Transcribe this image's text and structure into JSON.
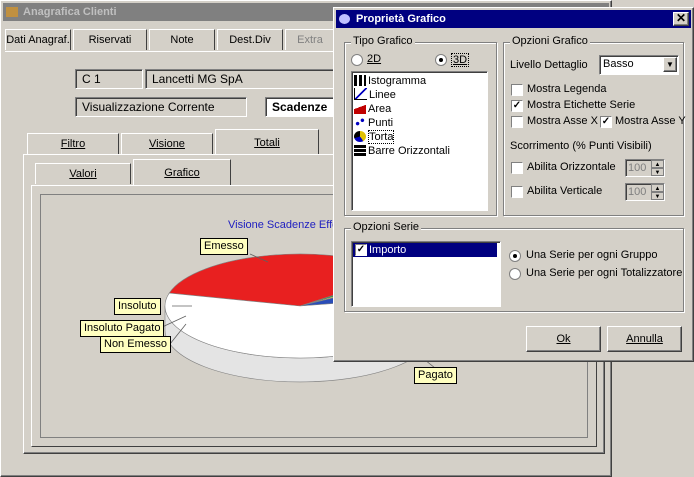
{
  "main_window": {
    "title": "Anagrafica Clienti",
    "top_tabs": [
      "Dati Anagraf.",
      "Riservati",
      "Note",
      "Dest.Div",
      "Extra"
    ],
    "code_field": "C    1",
    "name_field": "Lancetti MG SpA",
    "view_label": "Visualizzazione Corrente",
    "view_select": "Scadenze",
    "sub_tabs": [
      "Filtro",
      "Visione",
      "Totali"
    ],
    "inner_tabs": [
      "Valori",
      "Grafico"
    ],
    "chart_title": "Visione Scadenze Effe"
  },
  "chart_data": {
    "type": "pie",
    "title": "Visione Scadenze Effe",
    "categories": [
      "Emesso",
      "Insoluto",
      "Insoluto Pagato",
      "Non Emesso",
      "Pagato"
    ],
    "series": [
      {
        "name": "Importo",
        "values": [
          35,
          1,
          1,
          6,
          57
        ]
      }
    ],
    "colors": [
      "#e82020",
      "#1f9a3a",
      "#e8e050",
      "#2a4db8",
      "#ffffff"
    ],
    "legend_placement": "callouts"
  },
  "dialog": {
    "title": "Proprietà Grafico",
    "close_icon": "close-icon",
    "tipo_grafico": {
      "label": "Tipo Grafico",
      "radio_2d": "2D",
      "radio_3d": "3D",
      "selected": "3D",
      "items": [
        {
          "label": "Istogramma",
          "icon": "bar-chart-icon"
        },
        {
          "label": "Linee",
          "icon": "line-chart-icon"
        },
        {
          "label": "Area",
          "icon": "area-chart-icon"
        },
        {
          "label": "Punti",
          "icon": "scatter-chart-icon"
        },
        {
          "label": "Torta",
          "icon": "pie-chart-icon"
        },
        {
          "label": "Barre Orizzontali",
          "icon": "hbar-chart-icon"
        }
      ],
      "selected_item": "Torta"
    },
    "opzioni_grafico": {
      "label": "Opzioni Grafico",
      "livello_label": "Livello Dettaglio",
      "livello_value": "Basso",
      "mostra_legenda": "Mostra Legenda",
      "mostra_legenda_checked": false,
      "mostra_etichette": "Mostra Etichette Serie",
      "mostra_etichette_checked": true,
      "mostra_asse_x": "Mostra Asse X",
      "mostra_asse_x_checked": false,
      "mostra_asse_y": "Mostra Asse Y",
      "mostra_asse_y_checked": true,
      "scorrimento_label": "Scorrimento (% Punti Visibili)",
      "abilita_orizzontale": "Abilita Orizzontale",
      "abilita_verticale": "Abilita Verticale",
      "orizzontale_value": "100",
      "verticale_value": "100"
    },
    "opzioni_serie": {
      "label": "Opzioni Serie",
      "series_item": "Importo",
      "series_checked": true,
      "radio_gruppo": "Una Serie per ogni Gruppo",
      "radio_totalizzatore": "Una Serie per ogni Totalizzatore",
      "selected": "gruppo"
    },
    "ok_button": "Ok",
    "annulla_button": "Annulla"
  }
}
